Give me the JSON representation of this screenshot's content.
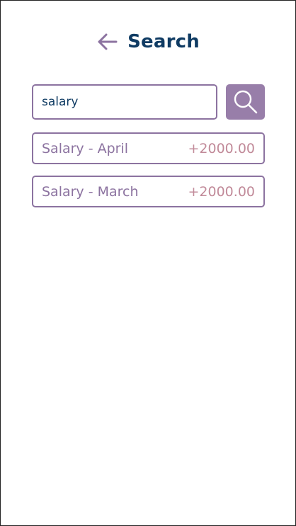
{
  "header": {
    "title": "Search",
    "back_icon": "arrow-left-icon"
  },
  "search": {
    "value": "salary",
    "placeholder": "",
    "button_icon": "search-icon"
  },
  "results": [
    {
      "name": "Salary - April",
      "amount": "+2000.00"
    },
    {
      "name": "Salary - March",
      "amount": "+2000.00"
    }
  ],
  "colors": {
    "title": "#0f3b63",
    "accent": "#8c73a0",
    "button_bg": "#987ea9",
    "amount": "#c18a99"
  }
}
